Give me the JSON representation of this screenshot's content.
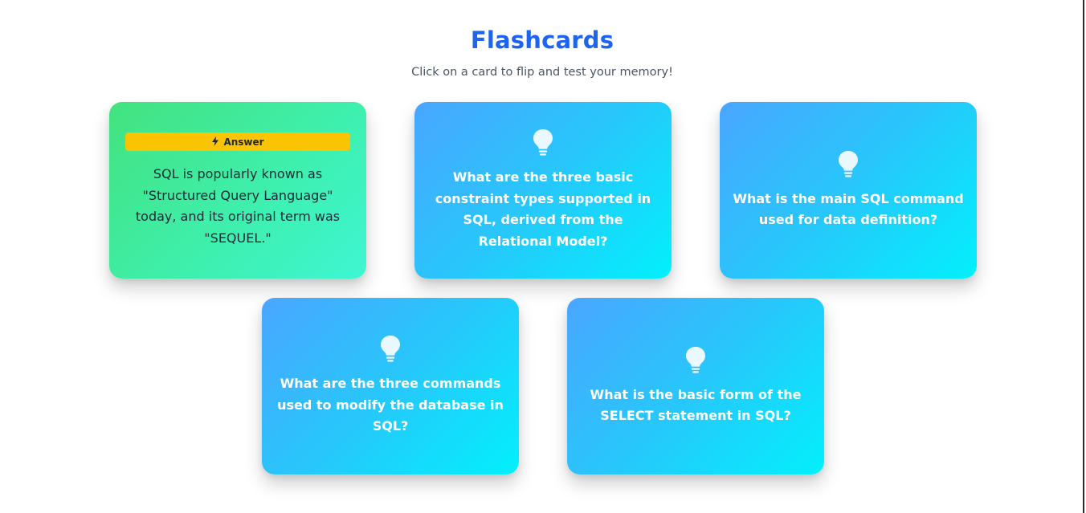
{
  "header": {
    "title": "Flashcards",
    "subtitle": "Click on a card to flip and test your memory!"
  },
  "cards": [
    {
      "state": "answer",
      "badge_icon": "lightning-icon",
      "badge_label": "Answer",
      "text": "SQL is popularly known as \"Structured Query Language\" today, and its original term was \"SEQUEL.\""
    },
    {
      "state": "question",
      "icon": "lightbulb-icon",
      "text": "What are the three basic constraint types supported in SQL, derived from the Relational Model?"
    },
    {
      "state": "question",
      "icon": "lightbulb-icon",
      "text": "What is the main SQL command used for data definition?"
    },
    {
      "state": "question",
      "icon": "lightbulb-icon",
      "text": "What are the three commands used to modify the database in SQL?"
    },
    {
      "state": "question",
      "icon": "lightbulb-icon",
      "text": "What is the basic form of the SELECT statement in SQL?"
    }
  ],
  "colors": {
    "title": "#1d64f0",
    "question_gradient_start": "#4aa6ff",
    "question_gradient_end": "#02f0fc",
    "answer_gradient_start": "#43e27e",
    "answer_gradient_end": "#3ef6d3",
    "badge": "#fbc402"
  }
}
